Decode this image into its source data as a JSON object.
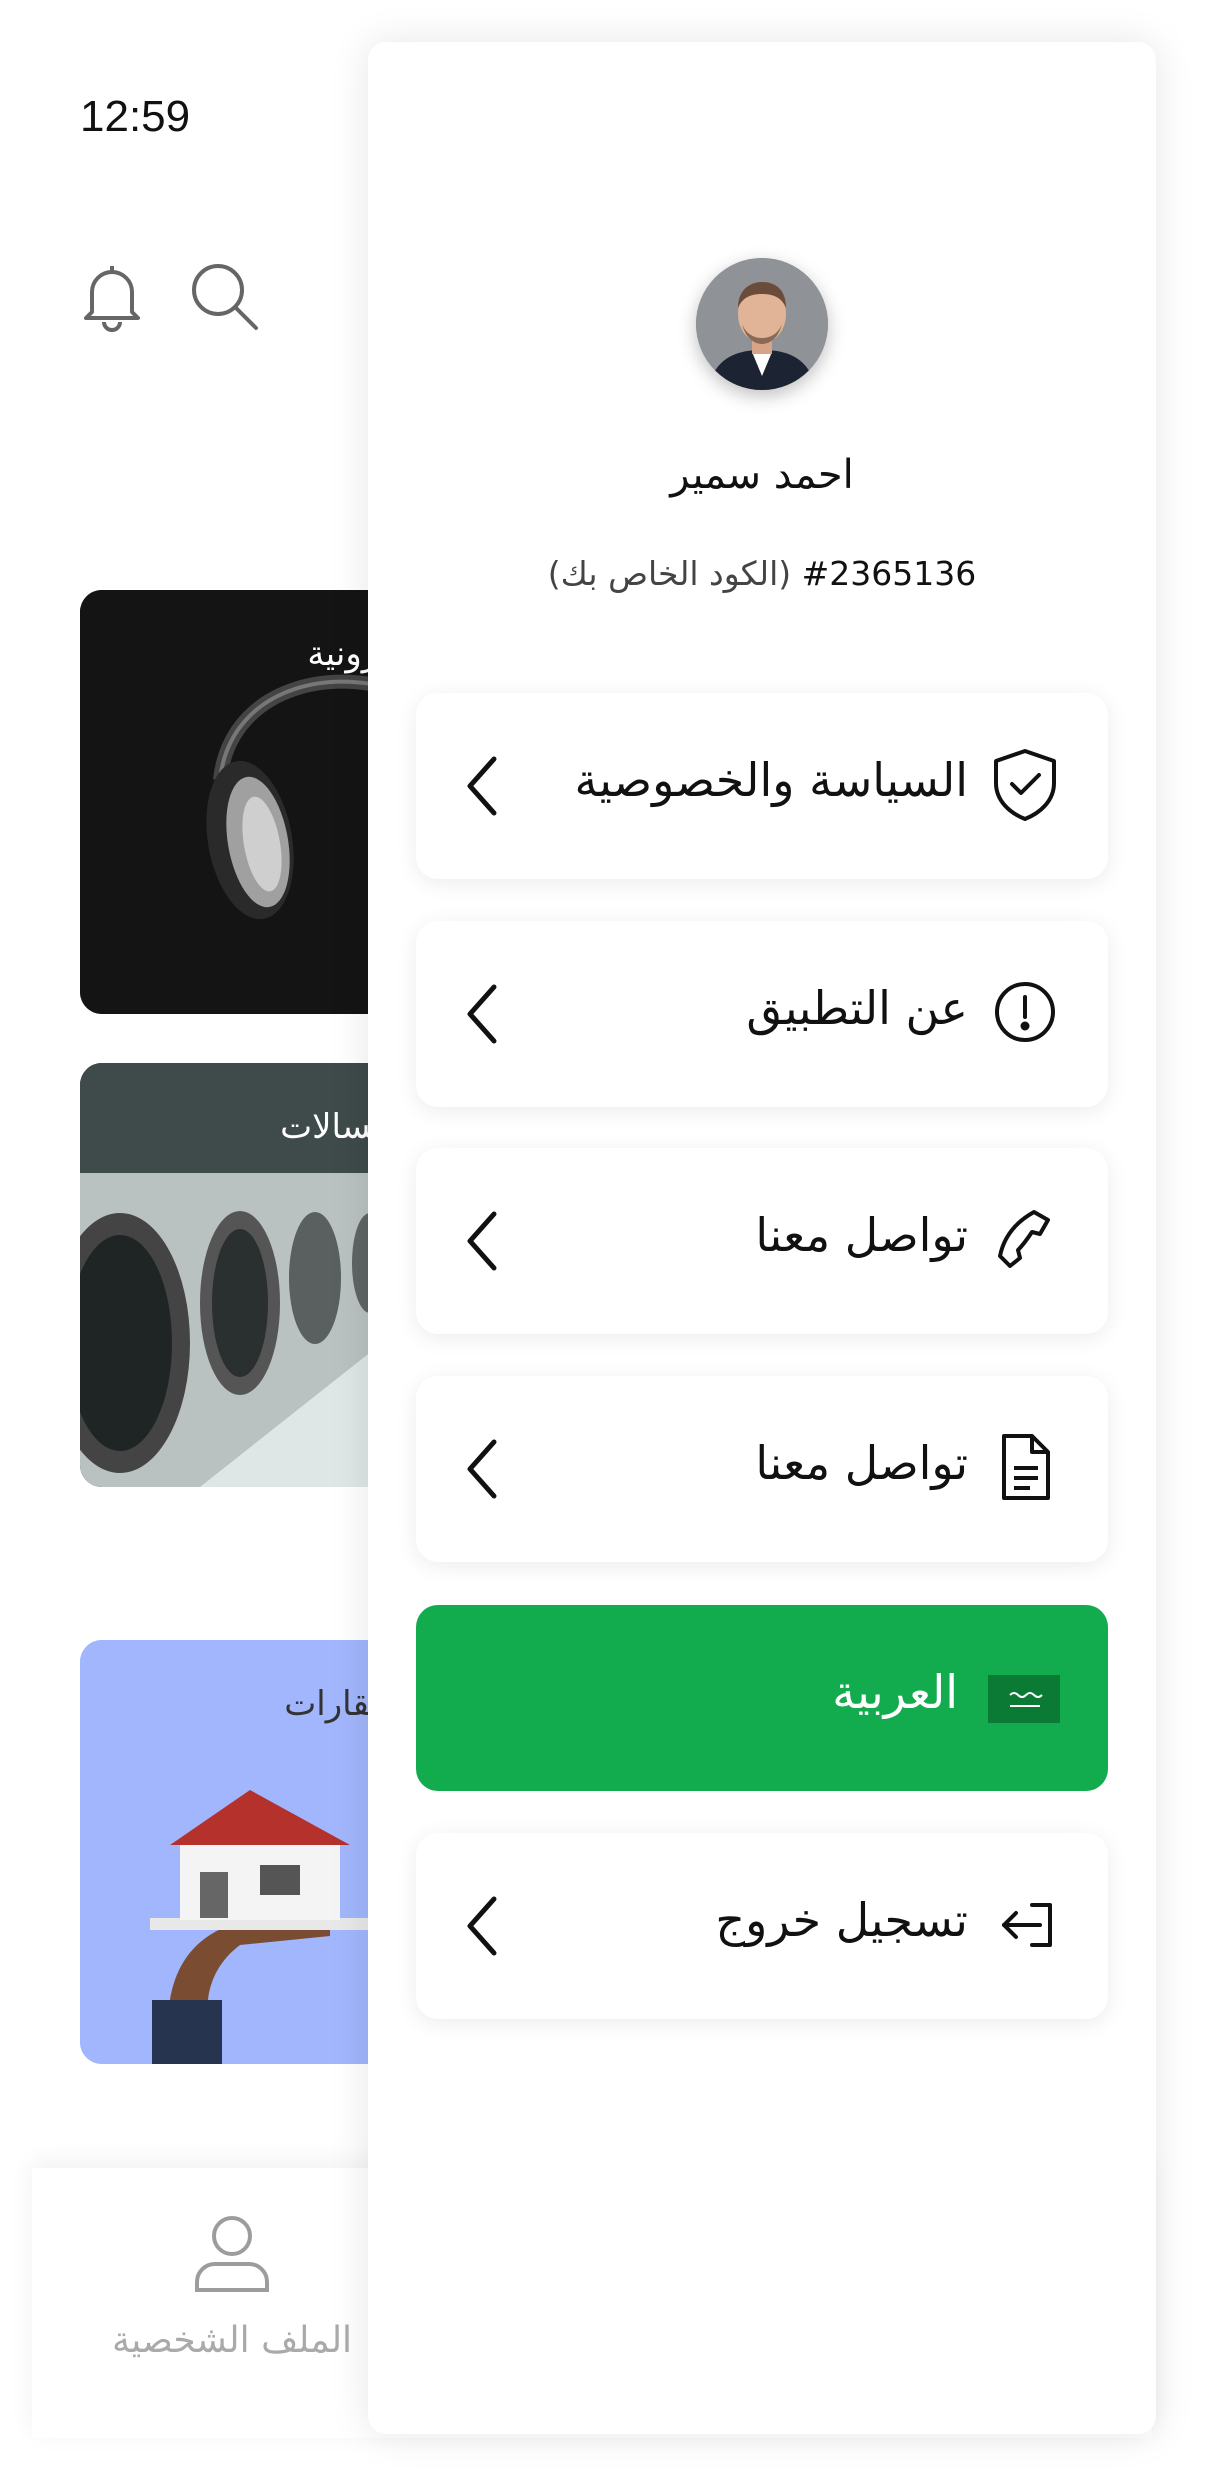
{
  "status_bar": {
    "time": "12:59"
  },
  "categories": [
    {
      "title": "ترونية"
    },
    {
      "title": "غسالات"
    },
    {
      "title": "عقارات"
    }
  ],
  "bottom_nav": {
    "profile_label": "الملف الشخصية"
  },
  "drawer": {
    "user": {
      "name": "احمد سمير",
      "code": "#2365136",
      "code_caption": "(الكود الخاص بك)"
    },
    "menu": [
      {
        "label": "السياسة والخصوصية",
        "icon": "shield-check-icon"
      },
      {
        "label": "عن التطبيق",
        "icon": "info-circle-icon"
      },
      {
        "label": "تواصل معنا",
        "icon": "phone-icon"
      },
      {
        "label": "تواصل معنا",
        "icon": "document-icon"
      },
      {
        "label": "العربية",
        "icon": "saudi-flag-icon",
        "active": true
      },
      {
        "label": "تسجيل خروج",
        "icon": "logout-icon"
      }
    ],
    "accent_color": "#12ac4f"
  }
}
